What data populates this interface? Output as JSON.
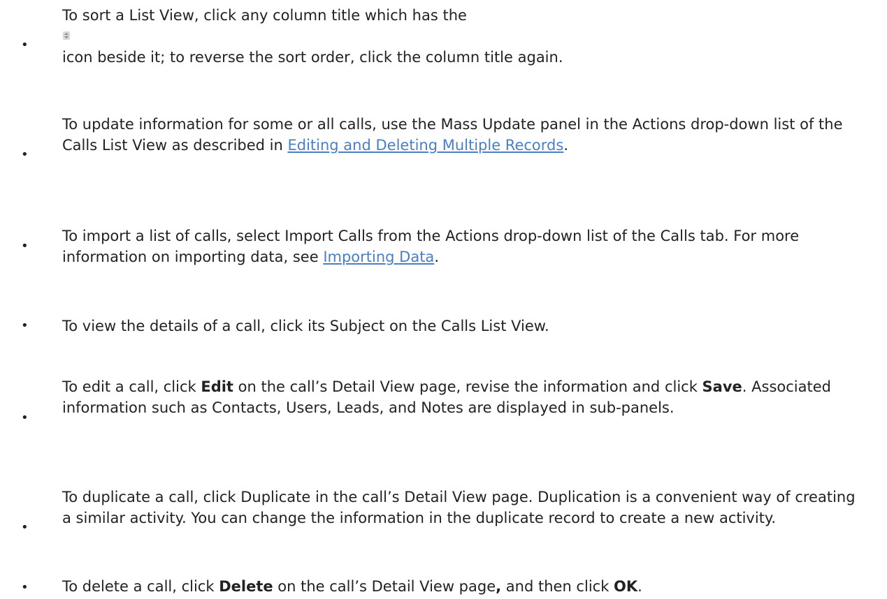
{
  "items": [
    {
      "part1": "To sort a List View, click any column title which has the",
      "icon": "sort-icon",
      "part2": "icon beside it; to reverse the sort order, click the column title again."
    },
    {
      "text1": "To update information for some or all calls, use the Mass Update panel in the Actions drop-down list of the Calls List View as described in ",
      "link": "Editing and Deleting Multiple Records",
      "text2": "."
    },
    {
      "text1": "To import a list of calls, select Import Calls from the Actions drop-down list of the Calls tab. For more information on importing data, see ",
      "link": "Importing Data",
      "text2": "."
    },
    {
      "text": "To view the details of a call, click its Subject on the Calls List View."
    },
    {
      "text1": "To edit a call, click ",
      "bold1": "Edit",
      "text2": " on the call’s Detail View page, revise the information and click ",
      "bold2": "Save",
      "text3": ". Associated information such as Contacts, Users, Leads, and Notes are displayed in sub-panels."
    },
    {
      "text": "To duplicate a call, click Duplicate in the call’s Detail View page. Duplication is a convenient way of creating a similar activity. You can change the information in the duplicate record to create a new activity."
    },
    {
      "text1": "To delete a call, click ",
      "bold1": "Delete",
      "text2": " on the call’s Detail View page",
      "bold2": ",",
      "text3": " and then click ",
      "bold3": "OK",
      "text4": "."
    }
  ],
  "bullet": "•",
  "colors": {
    "text": "#222222",
    "link": "#4a7fc8"
  }
}
